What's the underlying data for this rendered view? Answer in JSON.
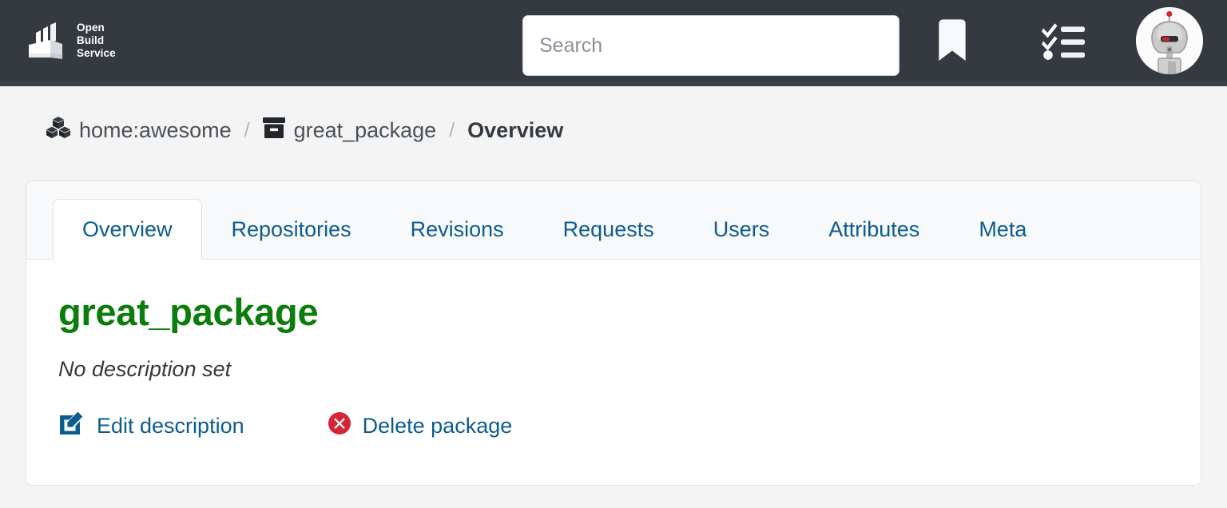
{
  "brand": {
    "line1": "Open",
    "line2": "Build",
    "line3": "Service",
    "logo_icon": "obs-factory-logo"
  },
  "search": {
    "placeholder": "Search",
    "value": ""
  },
  "navicons": [
    {
      "name": "bookmark-icon",
      "label": "Bookmarks"
    },
    {
      "name": "tasks-icon",
      "label": "Tasks"
    },
    {
      "name": "user-avatar",
      "label": "User avatar"
    }
  ],
  "breadcrumb": {
    "project": "home:awesome",
    "project_icon": "cubes-icon",
    "package": "great_package",
    "package_icon": "archive-box-icon",
    "current": "Overview",
    "separator": "/"
  },
  "tabs": [
    {
      "label": "Overview",
      "active": true
    },
    {
      "label": "Repositories",
      "active": false
    },
    {
      "label": "Revisions",
      "active": false
    },
    {
      "label": "Requests",
      "active": false
    },
    {
      "label": "Users",
      "active": false
    },
    {
      "label": "Attributes",
      "active": false
    },
    {
      "label": "Meta",
      "active": false
    }
  ],
  "package": {
    "title": "great_package",
    "description": "No description set"
  },
  "actions": {
    "edit": {
      "label": "Edit description",
      "icon": "pen-to-square-icon"
    },
    "delete": {
      "label": "Delete package",
      "icon": "circle-xmark-icon"
    }
  },
  "colors": {
    "navbar": "#343a40",
    "page_bg": "#f4f4f4",
    "link": "#0c5c8f",
    "title_green": "#0a7d0a",
    "danger_red": "#d32535",
    "card_border": "#dee2e6",
    "tab_bar_bg": "#f8f9fa"
  }
}
